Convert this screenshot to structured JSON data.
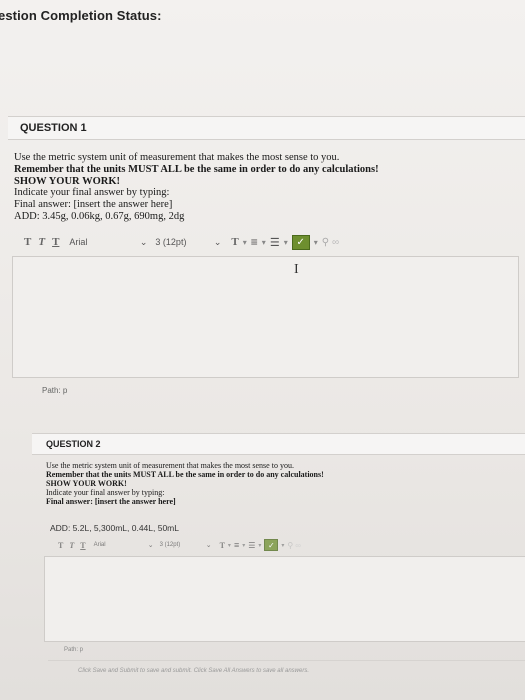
{
  "page": {
    "status_title": "estion Completion Status:"
  },
  "q1": {
    "title": "QUESTION 1",
    "lines": [
      "Use the metric system unit of measurement that makes the most sense to you.",
      "Remember that the units MUST ALL be the same in order to do any calculations!",
      "SHOW YOUR WORK!",
      "Indicate your final answer by typing:",
      "Final answer: [insert the answer here]",
      "ADD: 3.45g, 0.06kg, 0.67g, 690mg, 2dg"
    ],
    "toolbar": {
      "bold": "T",
      "italic": "T",
      "underline": "T",
      "font": "Arial",
      "size": "3 (12pt)",
      "text_color": "T",
      "align": "≡",
      "list": "☰",
      "check": "✓"
    },
    "path": "Path: p"
  },
  "q2": {
    "title": "QUESTION 2",
    "lines": [
      "Use the metric system unit of measurement that makes the most sense to you.",
      "Remember that the units MUST ALL be the same in order to do any calculations!",
      "SHOW YOUR WORK!",
      "Indicate your final answer by typing:",
      "Final answer: [insert the answer here]"
    ],
    "add_line": "ADD: 5.2L, 5,300mL, 0.44L, 50mL",
    "toolbar": {
      "bold": "T",
      "italic": "T",
      "underline": "T",
      "font": "Arial",
      "size": "3 (12pt)",
      "text_color": "T",
      "align": "≡",
      "list": "☰",
      "check": "✓"
    },
    "path": "Path: p"
  },
  "footer": {
    "text": "Click Save and Submit to save and submit. Click Save All Answers to save all answers."
  }
}
